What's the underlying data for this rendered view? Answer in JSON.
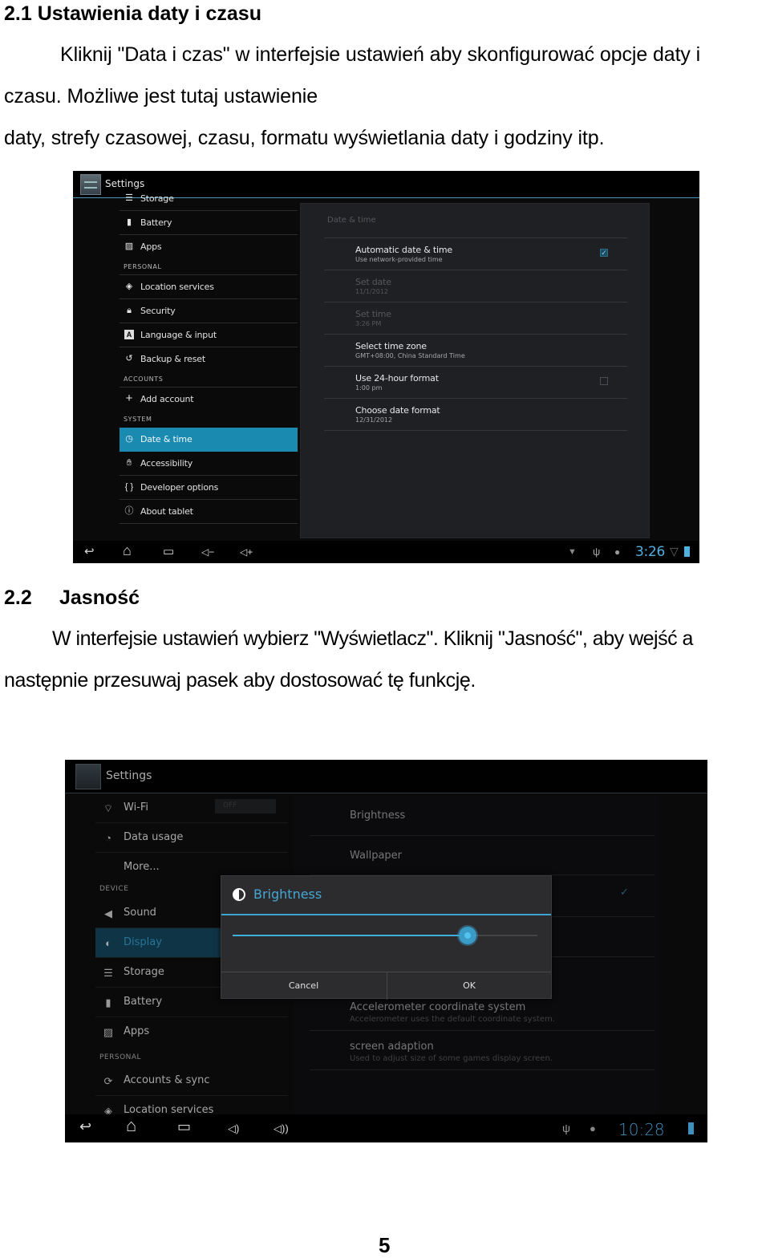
{
  "section1": {
    "heading": "2.1 Ustawienia daty i czasu",
    "para_line1": "Kliknij \"Data i czas\" w interfejsie ustawień aby skonfigurować opcje daty i",
    "para_line2": "czasu. Możliwe jest tutaj ustawienie",
    "para_line3": "daty, strefy czasowej, czasu, formatu wyświetlania daty i godziny itp."
  },
  "screen1": {
    "app_title": "Settings",
    "sidebar": {
      "items": [
        {
          "label": "Storage",
          "icon": "storage-icon"
        },
        {
          "label": "Battery",
          "icon": "battery-icon"
        },
        {
          "label": "Apps",
          "icon": "apps-icon"
        },
        {
          "label": "Location services",
          "icon": "location-icon"
        },
        {
          "label": "Security",
          "icon": "lock-icon"
        },
        {
          "label": "Language & input",
          "icon": "language-icon"
        },
        {
          "label": "Backup & reset",
          "icon": "backup-icon"
        },
        {
          "label": "Add account",
          "icon": "plus-icon"
        },
        {
          "label": "Date & time",
          "icon": "clock-icon",
          "active": true
        },
        {
          "label": "Accessibility",
          "icon": "hand-icon"
        },
        {
          "label": "Developer options",
          "icon": "braces-icon"
        },
        {
          "label": "About tablet",
          "icon": "info-icon"
        }
      ],
      "categories": [
        "PERSONAL",
        "ACCOUNTS",
        "SYSTEM"
      ]
    },
    "panel": {
      "title": "Date & time",
      "prefs": [
        {
          "title": "Automatic date & time",
          "summary": "Use network-provided time",
          "checked": true
        },
        {
          "title": "Set date",
          "summary": "11/1/2012",
          "disabled": true
        },
        {
          "title": "Set time",
          "summary": "3:26 PM",
          "disabled": true
        },
        {
          "title": "Select time zone",
          "summary": "GMT+08:00, China Standard Time"
        },
        {
          "title": "Use 24-hour format",
          "summary": "1:00 pm",
          "checked": false
        },
        {
          "title": "Choose date format",
          "summary": "12/31/2012"
        }
      ]
    },
    "statusbar": {
      "clock": "3:26",
      "back": "↩",
      "home": "⌂",
      "recents": "▭",
      "vol_down": "◁−",
      "vol_up": "◁+"
    },
    "accent": "#1a8ab0"
  },
  "section2": {
    "heading_number": "2.2",
    "heading_title": "Jasność",
    "para_line1": "W interfejsie ustawień wybierz \"Wyświetlacz\". Kliknij \"Jasność\", aby wejść a",
    "para_line2": "następnie przesuwaj pasek aby dostosować tę funkcję."
  },
  "screen2": {
    "app_title": "Settings",
    "sidebar": {
      "items": [
        {
          "label": "Wi-Fi",
          "icon": "wifi-icon"
        },
        {
          "label": "Data usage",
          "icon": "data-usage-icon"
        },
        {
          "label": "More...",
          "icon": ""
        },
        {
          "label": "Sound",
          "icon": "speaker-icon"
        },
        {
          "label": "Display",
          "icon": "display-icon",
          "active": true
        },
        {
          "label": "Storage",
          "icon": "storage-icon"
        },
        {
          "label": "Battery",
          "icon": "battery-icon"
        },
        {
          "label": "Apps",
          "icon": "apps-icon"
        },
        {
          "label": "Accounts & sync",
          "icon": "sync-icon"
        },
        {
          "label": "Location services",
          "icon": "location-icon"
        }
      ],
      "categories": [
        "DEVICE",
        "PERSONAL"
      ],
      "wifi_toggle": "OFF"
    },
    "panel": {
      "prefs": [
        {
          "title": "Brightness"
        },
        {
          "title": "Wallpaper"
        },
        {
          "title": "Accelerometer coordinate system",
          "summary": "Accelerometer uses the default coordinate system."
        },
        {
          "title": "screen adaption",
          "summary": "Used to adjust size of some games display screen."
        }
      ]
    },
    "dialog": {
      "title": "Brightness",
      "slider_value_percent": 77,
      "cancel_label": "Cancel",
      "ok_label": "OK"
    },
    "statusbar": {
      "clock": "10:28"
    },
    "accent": "#3fa4d2"
  },
  "page_number": "5"
}
